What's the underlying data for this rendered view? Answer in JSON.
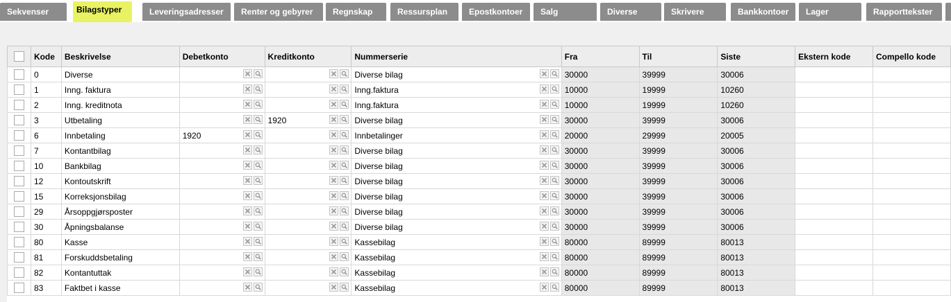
{
  "tabs": [
    {
      "label": "Sekvenser",
      "active": false
    },
    {
      "label": "Bilagstyper",
      "active": true
    },
    {
      "label": "Leveringsadresser",
      "active": false
    },
    {
      "label": "Renter og gebyrer",
      "active": false
    },
    {
      "label": "Regnskap",
      "active": false
    },
    {
      "label": "Ressursplan",
      "active": false
    },
    {
      "label": "Epostkontoer",
      "active": false
    },
    {
      "label": "Salg",
      "active": false
    },
    {
      "label": "Diverse",
      "active": false
    },
    {
      "label": "Skrivere",
      "active": false
    },
    {
      "label": "Bankkontoer",
      "active": false
    },
    {
      "label": "Lager",
      "active": false
    },
    {
      "label": "Rapporttekster",
      "active": false
    }
  ],
  "grid": {
    "headers": {
      "kode": "Kode",
      "beskrivelse": "Beskrivelse",
      "debetkonto": "Debetkonto",
      "kreditkonto": "Kreditkonto",
      "nummerserie": "Nummerserie",
      "fra": "Fra",
      "til": "Til",
      "siste": "Siste",
      "ekstern": "Ekstern kode",
      "compello": "Compello kode"
    },
    "icons": {
      "clear": "clear-x-icon",
      "lookup": "magnifier-icon"
    },
    "rows": [
      {
        "kode": "0",
        "beskrivelse": "Diverse",
        "debet": "",
        "kredit": "",
        "serie": "Diverse bilag",
        "fra": "30000",
        "til": "39999",
        "siste": "30006"
      },
      {
        "kode": "1",
        "beskrivelse": "Inng. faktura",
        "debet": "",
        "kredit": "",
        "serie": "Inng.faktura",
        "fra": "10000",
        "til": "19999",
        "siste": "10260"
      },
      {
        "kode": "2",
        "beskrivelse": "Inng. kreditnota",
        "debet": "",
        "kredit": "",
        "serie": "Inng.faktura",
        "fra": "10000",
        "til": "19999",
        "siste": "10260"
      },
      {
        "kode": "3",
        "beskrivelse": "Utbetaling",
        "debet": "",
        "kredit": "1920",
        "serie": "Diverse bilag",
        "fra": "30000",
        "til": "39999",
        "siste": "30006"
      },
      {
        "kode": "6",
        "beskrivelse": "Innbetaling",
        "debet": "1920",
        "kredit": "",
        "serie": "Innbetalinger",
        "fra": "20000",
        "til": "29999",
        "siste": "20005"
      },
      {
        "kode": "7",
        "beskrivelse": "Kontantbilag",
        "debet": "",
        "kredit": "",
        "serie": "Diverse bilag",
        "fra": "30000",
        "til": "39999",
        "siste": "30006"
      },
      {
        "kode": "10",
        "beskrivelse": "Bankbilag",
        "debet": "",
        "kredit": "",
        "serie": "Diverse bilag",
        "fra": "30000",
        "til": "39999",
        "siste": "30006"
      },
      {
        "kode": "12",
        "beskrivelse": "Kontoutskrift",
        "debet": "",
        "kredit": "",
        "serie": "Diverse bilag",
        "fra": "30000",
        "til": "39999",
        "siste": "30006"
      },
      {
        "kode": "15",
        "beskrivelse": "Korreksjonsbilag",
        "debet": "",
        "kredit": "",
        "serie": "Diverse bilag",
        "fra": "30000",
        "til": "39999",
        "siste": "30006"
      },
      {
        "kode": "29",
        "beskrivelse": "Årsoppgjørsposter",
        "debet": "",
        "kredit": "",
        "serie": "Diverse bilag",
        "fra": "30000",
        "til": "39999",
        "siste": "30006"
      },
      {
        "kode": "30",
        "beskrivelse": "Åpningsbalanse",
        "debet": "",
        "kredit": "",
        "serie": "Diverse bilag",
        "fra": "30000",
        "til": "39999",
        "siste": "30006"
      },
      {
        "kode": "80",
        "beskrivelse": "Kasse",
        "debet": "",
        "kredit": "",
        "serie": "Kassebilag",
        "fra": "80000",
        "til": "89999",
        "siste": "80013"
      },
      {
        "kode": "81",
        "beskrivelse": "Forskuddsbetaling",
        "debet": "",
        "kredit": "",
        "serie": "Kassebilag",
        "fra": "80000",
        "til": "89999",
        "siste": "80013"
      },
      {
        "kode": "82",
        "beskrivelse": "Kontantuttak",
        "debet": "",
        "kredit": "",
        "serie": "Kassebilag",
        "fra": "80000",
        "til": "89999",
        "siste": "80013"
      },
      {
        "kode": "83",
        "beskrivelse": "Faktbet i kasse",
        "debet": "",
        "kredit": "",
        "serie": "Kassebilag",
        "fra": "80000",
        "til": "89999",
        "siste": "80013"
      }
    ]
  }
}
